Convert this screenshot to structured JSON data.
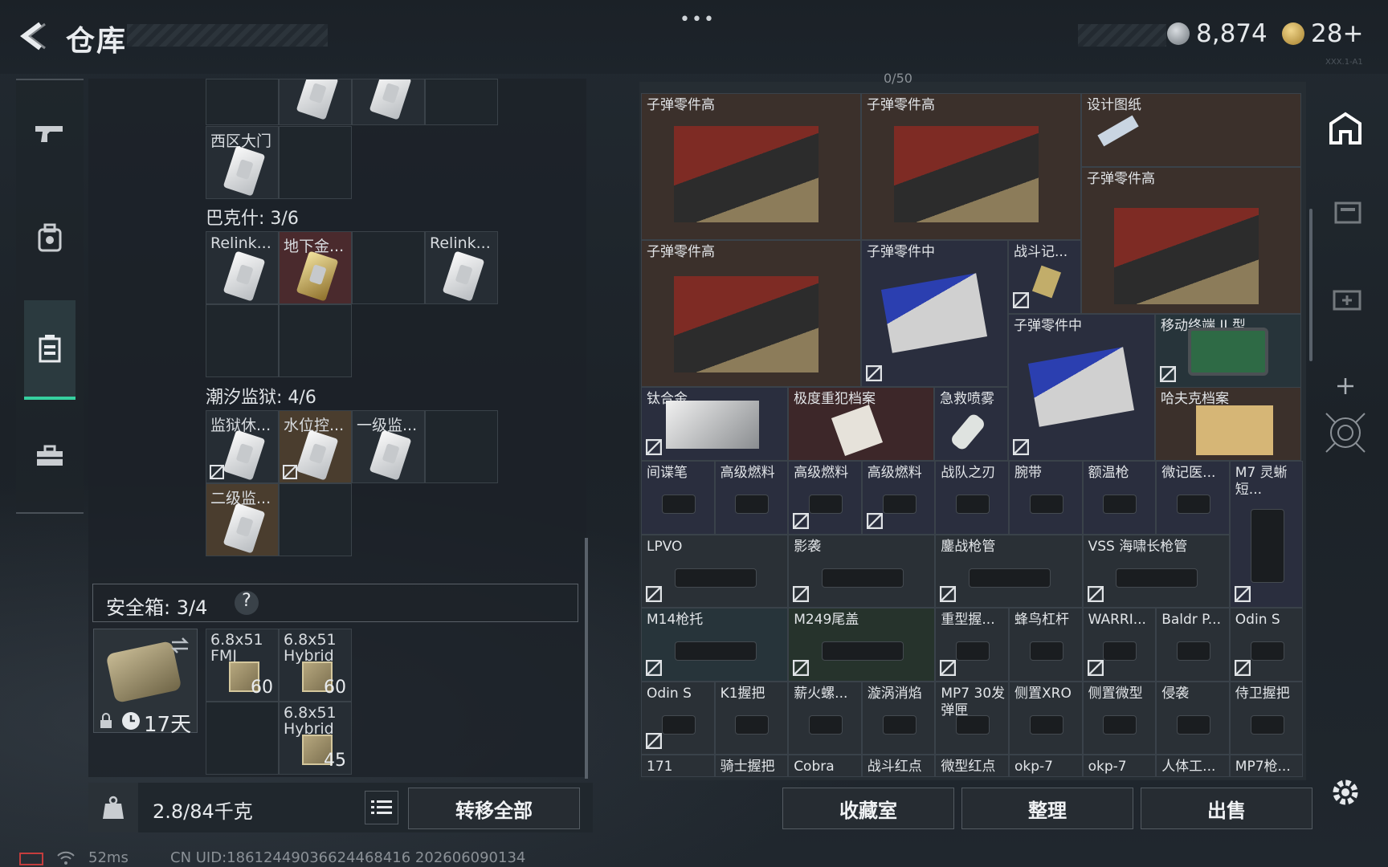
{
  "header": {
    "title": "仓库",
    "menu_dots": "•••",
    "currency": [
      {
        "icon": "silver-coin-icon",
        "value": "8,874"
      },
      {
        "icon": "gold-triangle-coin-icon",
        "value": "28+"
      }
    ],
    "version_hint": "XXX.1-A1"
  },
  "left_rail": {
    "items": [
      {
        "icon": "pistol-icon",
        "active": false
      },
      {
        "icon": "backpack-icon",
        "active": false
      },
      {
        "icon": "storage-case-icon",
        "active": true
      },
      {
        "icon": "toolbox-icon",
        "active": false
      }
    ]
  },
  "left_panel": {
    "top_row": {
      "label": "西区大门"
    },
    "sections": [
      {
        "title": "巴克什: 3/6",
        "items": [
          "Relink...",
          "地下金...",
          "",
          "Relink..."
        ]
      },
      {
        "title": "潮汐监狱: 4/6",
        "items": [
          "监狱休...",
          "水位控...",
          "一级监...",
          "",
          "二级监..."
        ]
      }
    ],
    "safe_box": {
      "label": "安全箱: 3/4",
      "help": "?",
      "duration": "17天",
      "items": [
        {
          "name": "6.8x51 FMJ",
          "count": "60"
        },
        {
          "name": "6.8x51 Hybrid",
          "count": "60"
        },
        {
          "name": "6.8x51 Hybrid",
          "count": "45"
        }
      ]
    },
    "weight": "2.8/84千克",
    "transfer_all_label": "转移全部"
  },
  "right_panel": {
    "top_partial": "0/50",
    "items": [
      {
        "label": "子弹零件高"
      },
      {
        "label": "子弹零件高"
      },
      {
        "label": "设计图纸"
      },
      {
        "label": "子弹零件高"
      },
      {
        "label": "子弹零件高"
      },
      {
        "label": "子弹零件中"
      },
      {
        "label": "战斗记..."
      },
      {
        "label": "子弹零件中"
      },
      {
        "label": "移动终端 II 型"
      },
      {
        "label": "钛合金"
      },
      {
        "label": "极度重犯档案"
      },
      {
        "label": "急救喷雾"
      },
      {
        "label": "哈夫克档案"
      },
      {
        "label": "间谍笔"
      },
      {
        "label": "高级燃料"
      },
      {
        "label": "高级燃料"
      },
      {
        "label": "高级燃料"
      },
      {
        "label": "战队之刃"
      },
      {
        "label": "腕带"
      },
      {
        "label": "额温枪"
      },
      {
        "label": "微记医..."
      },
      {
        "label": "M7 灵蜥短..."
      },
      {
        "label": "LPVO"
      },
      {
        "label": "影袭"
      },
      {
        "label": "鏖战枪管"
      },
      {
        "label": "VSS 海啸长枪管"
      },
      {
        "label": "M14枪托"
      },
      {
        "label": "M249尾盖"
      },
      {
        "label": "重型握..."
      },
      {
        "label": "蜂鸟杠杆"
      },
      {
        "label": "WARRI..."
      },
      {
        "label": "Baldr P..."
      },
      {
        "label": "Odin S"
      },
      {
        "label": "Odin S"
      },
      {
        "label": "K1握把"
      },
      {
        "label": "薪火螺..."
      },
      {
        "label": "漩涡消焰"
      },
      {
        "label": "MP7 30发弹匣"
      },
      {
        "label": "侧置XRO"
      },
      {
        "label": "侧置微型"
      },
      {
        "label": "侵袭"
      },
      {
        "label": "侍卫握把"
      },
      {
        "label": "171"
      },
      {
        "label": "骑士握把"
      },
      {
        "label": "Cobra"
      },
      {
        "label": "战斗红点"
      },
      {
        "label": "微型红点"
      },
      {
        "label": "okp-7"
      },
      {
        "label": "okp-7"
      },
      {
        "label": "人体工..."
      },
      {
        "label": "MP7枪..."
      }
    ],
    "buttons": {
      "collection": "收藏室",
      "sort": "整理",
      "sell": "出售"
    }
  },
  "status_bar": {
    "ping": "52ms",
    "uid": "CN UID:18612449036624468416 202606090134"
  }
}
